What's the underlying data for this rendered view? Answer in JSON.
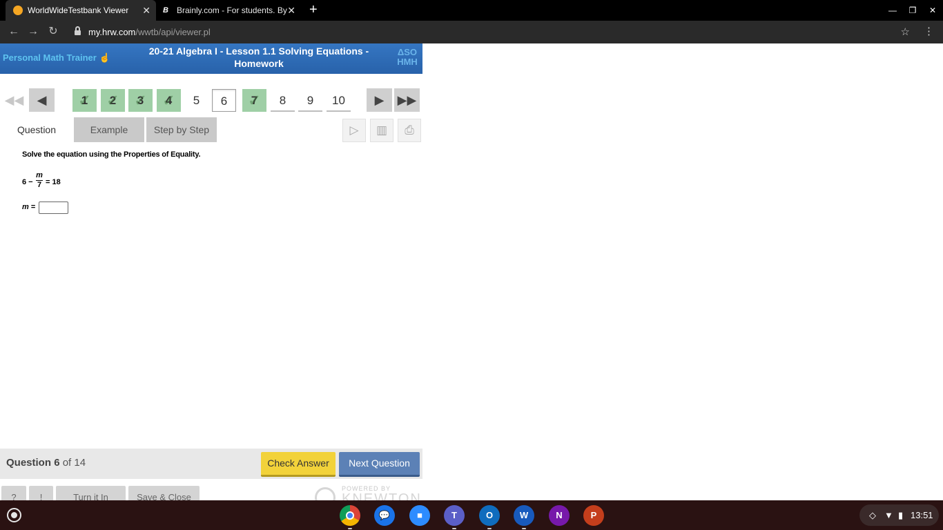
{
  "browser": {
    "tabs": [
      {
        "title": "WorldWideTestbank Viewer",
        "active": true
      },
      {
        "title": "Brainly.com - For students. By st",
        "active": false
      }
    ],
    "url_host": "my.hrw.com",
    "url_path": "/wwtb/api/viewer.pl"
  },
  "header": {
    "logo": "Personal Math Trainer",
    "title": "20-21 Algebra I - Lesson 1.1 Solving Equations - Homework",
    "brand_symbol": "ΔSO",
    "brand": "HMH"
  },
  "question_nav": {
    "items": [
      {
        "label": "1",
        "status": "done"
      },
      {
        "label": "2",
        "status": "done"
      },
      {
        "label": "3",
        "status": "done"
      },
      {
        "label": "4",
        "status": "done"
      },
      {
        "label": "5",
        "status": "plain"
      },
      {
        "label": "6",
        "status": "current"
      },
      {
        "label": "7",
        "status": "done"
      },
      {
        "label": "8",
        "status": "todo"
      },
      {
        "label": "9",
        "status": "todo"
      },
      {
        "label": "10",
        "status": "todo"
      }
    ]
  },
  "tabs": {
    "question": "Question",
    "example": "Example",
    "step_by_step": "Step by Step"
  },
  "question": {
    "instruction": "Solve the equation using the Properties of Equality.",
    "eq_lead": "6 −",
    "eq_numerator": "m",
    "eq_denominator": "7",
    "eq_tail": "= 18",
    "answer_var": "m",
    "answer_eq": "=",
    "answer_value": ""
  },
  "footer": {
    "question_word": "Question",
    "current_number": "6",
    "of_total": "of 14",
    "check_answer": "Check Answer",
    "next_question": "Next Question",
    "help": "?",
    "info": "!",
    "turn_it_in": "Turn it In",
    "save_close": "Save & Close",
    "powered_by": "POWERED BY",
    "knewton": "KNEWTON"
  },
  "taskbar": {
    "apps": [
      "chrome",
      "messages",
      "zoom",
      "teams",
      "outlook",
      "word",
      "onenote",
      "powerpoint"
    ],
    "time": "13:51"
  },
  "colors": {
    "header_blue": "#2f6db5",
    "done_green": "#9fcfa6",
    "check_yellow": "#f2d23a",
    "next_blue": "#5c81b6"
  }
}
